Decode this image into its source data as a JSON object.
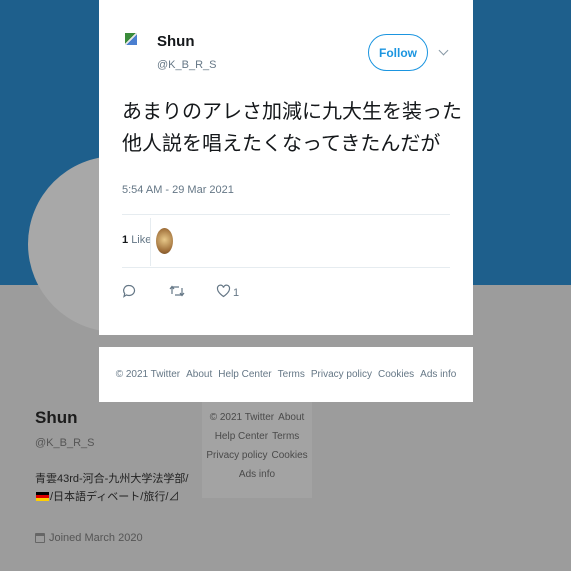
{
  "background_profile": {
    "name": "Shun",
    "handle": "@K_B_R_S",
    "bio_part1": "青雲43rd-河合-九州大学法学部/",
    "bio_part2": "/日本語ディベート/旅行/⊿",
    "joined": "Joined March 2020",
    "footer_links": [
      "© 2021 Twitter",
      "About",
      "Help Center",
      "Terms",
      "Privacy policy",
      "Cookies",
      "Ads info"
    ]
  },
  "tweet": {
    "author_name": "Shun",
    "author_handle": "@K_B_R_S",
    "follow_label": "Follow",
    "text": "あまりのアレさ加減に九大生を装った他人説を唱えたくなってきたんだが",
    "timestamp": "5:54 AM - 29 Mar 2021",
    "likes_count": "1",
    "likes_label": "Like",
    "action_like_count": "1"
  },
  "footer": {
    "links": [
      "© 2021 Twitter",
      "About",
      "Help Center",
      "Terms",
      "Privacy policy",
      "Cookies",
      "Ads info"
    ]
  },
  "colors": {
    "accent": "#1b95e0",
    "header_bg": "#1e5f8c",
    "overlay_bg": "#9c9c9c"
  }
}
